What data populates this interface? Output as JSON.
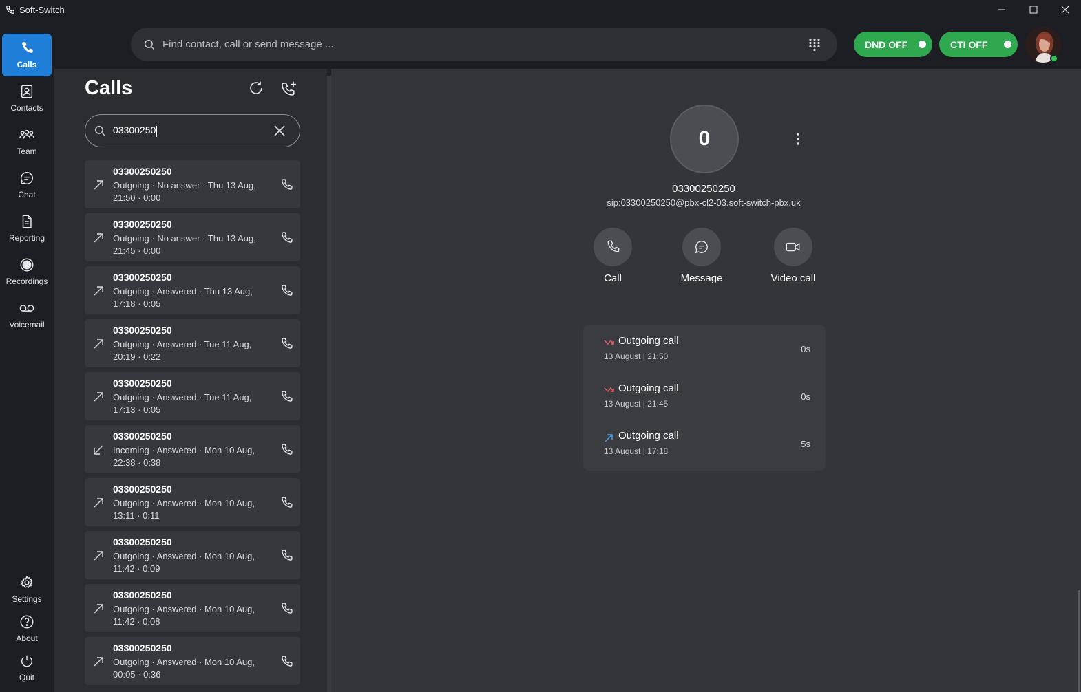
{
  "window": {
    "title": "Soft-Switch",
    "controls": [
      "minimize-icon",
      "maximize-icon",
      "close-icon"
    ]
  },
  "nav": {
    "items": [
      {
        "label": "Calls",
        "icon": "phone-icon",
        "active": true
      },
      {
        "label": "Contacts",
        "icon": "contact-card-icon"
      },
      {
        "label": "Team",
        "icon": "team-icon"
      },
      {
        "label": "Chat",
        "icon": "chat-bubble-icon"
      },
      {
        "label": "Reporting",
        "icon": "document-icon"
      },
      {
        "label": "Recordings",
        "icon": "record-icon"
      },
      {
        "label": "Voicemail",
        "icon": "voicemail-icon"
      }
    ],
    "bottom": [
      {
        "label": "Settings",
        "icon": "gear-icon"
      },
      {
        "label": "About",
        "icon": "help-circle-icon"
      },
      {
        "label": "Quit",
        "icon": "power-icon"
      }
    ]
  },
  "topbar": {
    "search_placeholder": "Find contact, call or send message ...",
    "dnd_label": "DND OFF",
    "cti_label": "CTI OFF",
    "toggle_color": "#2fa84f",
    "presence_color": "#2fc35b"
  },
  "calls": {
    "title": "Calls",
    "filter_value": "03300250",
    "items": [
      {
        "number": "03300250250",
        "direction": "outgoing",
        "meta": "Outgoing · No answer · Thu 13 Aug, 21:50 · 0:00"
      },
      {
        "number": "03300250250",
        "direction": "outgoing",
        "meta": "Outgoing · No answer · Thu 13 Aug, 21:45 · 0:00"
      },
      {
        "number": "03300250250",
        "direction": "outgoing",
        "meta": "Outgoing · Answered · Thu 13 Aug, 17:18 · 0:05"
      },
      {
        "number": "03300250250",
        "direction": "outgoing",
        "meta": "Outgoing · Answered · Tue 11 Aug, 20:19 · 0:22"
      },
      {
        "number": "03300250250",
        "direction": "outgoing",
        "meta": "Outgoing · Answered · Tue 11 Aug, 17:13 · 0:05"
      },
      {
        "number": "03300250250",
        "direction": "incoming",
        "meta": "Incoming · Answered · Mon 10 Aug, 22:38 · 0:38"
      },
      {
        "number": "03300250250",
        "direction": "outgoing",
        "meta": "Outgoing · Answered · Mon 10 Aug, 13:11 · 0:11"
      },
      {
        "number": "03300250250",
        "direction": "outgoing",
        "meta": "Outgoing · Answered · Mon 10 Aug, 11:42 · 0:09"
      },
      {
        "number": "03300250250",
        "direction": "outgoing",
        "meta": "Outgoing · Answered · Mon 10 Aug, 11:42 · 0:08"
      },
      {
        "number": "03300250250",
        "direction": "outgoing",
        "meta": "Outgoing · Answered · Mon 10 Aug, 00:05 · 0:36"
      }
    ]
  },
  "detail": {
    "avatar_initial": "0",
    "number": "03300250250",
    "sip": "sip:03300250250@pbx-cl2-03.soft-switch-pbx.uk",
    "actions": {
      "call": "Call",
      "message": "Message",
      "video": "Video call"
    },
    "history": [
      {
        "title": "Outgoing call",
        "date": "13 August | 21:50",
        "duration": "0s",
        "status": "missed",
        "color": "#e0606a"
      },
      {
        "title": "Outgoing call",
        "date": "13 August | 21:45",
        "duration": "0s",
        "status": "missed",
        "color": "#e0606a"
      },
      {
        "title": "Outgoing call",
        "date": "13 August | 17:18",
        "duration": "5s",
        "status": "answered",
        "color": "#4a9fe8"
      }
    ]
  },
  "colors": {
    "accent": "#1f7fd8"
  }
}
